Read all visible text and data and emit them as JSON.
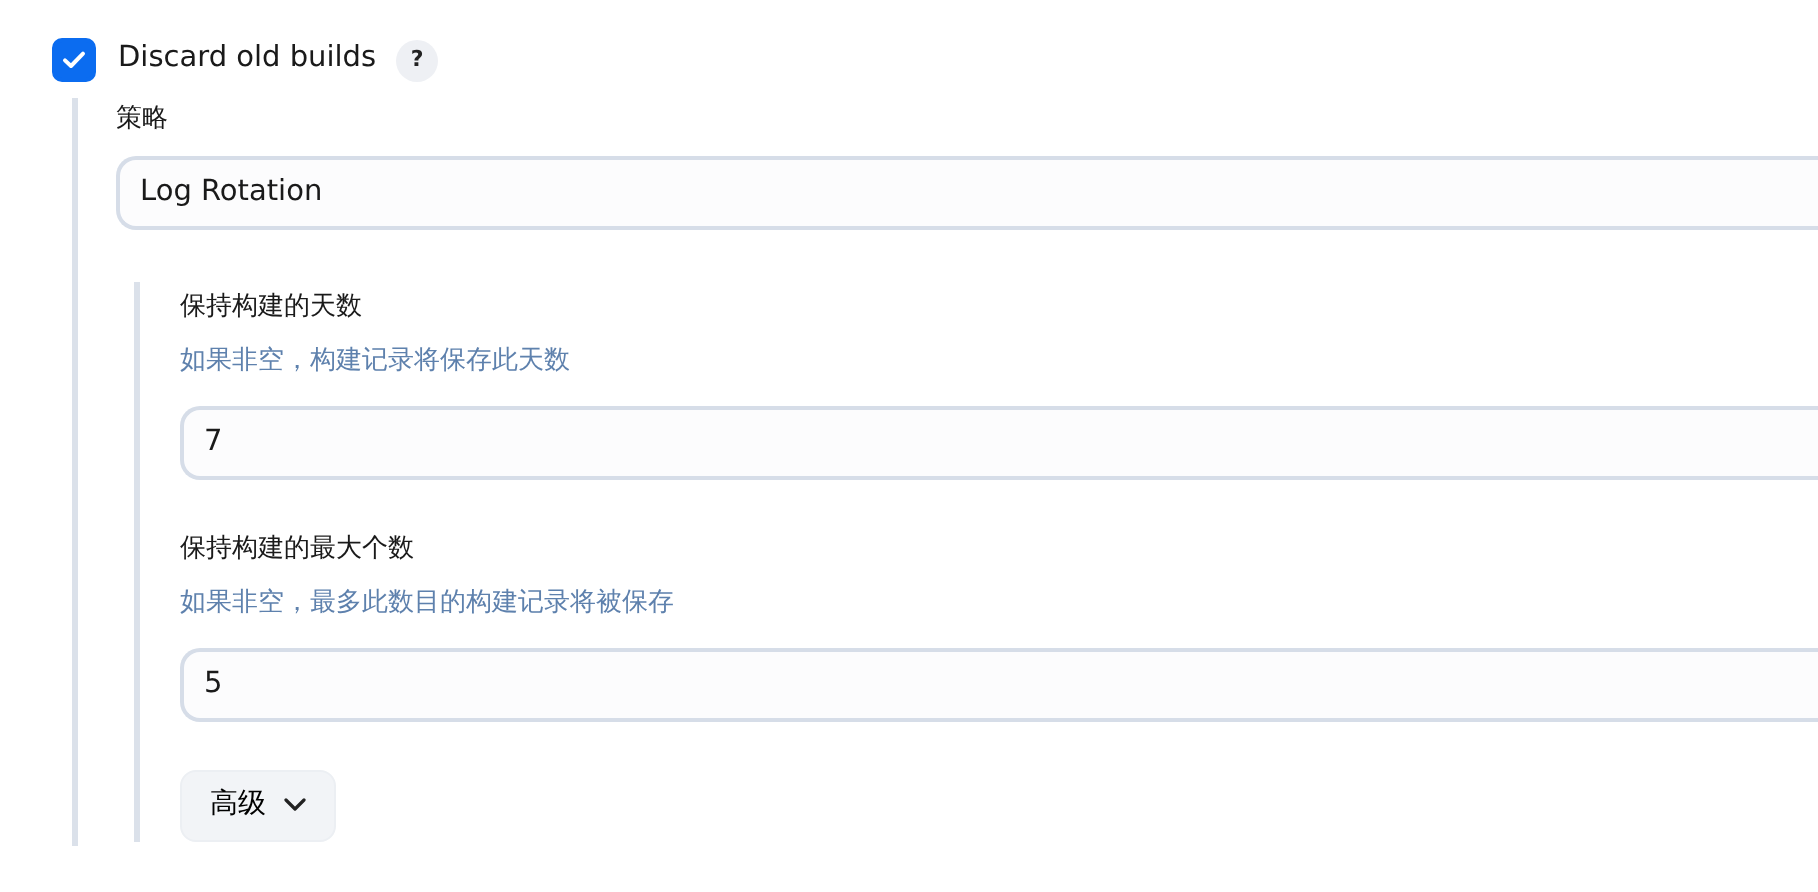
{
  "option": {
    "label": "Discard old builds",
    "checked": true,
    "help": "?"
  },
  "strategy": {
    "label": "策略",
    "value": "Log Rotation"
  },
  "fields": [
    {
      "label": "保持构建的天数",
      "hint": "如果非空，构建记录将保存此天数",
      "value": "7"
    },
    {
      "label": "保持构建的最大个数",
      "hint": "如果非空，最多此数目的构建记录将被保存",
      "value": "5"
    }
  ],
  "advanced_button": {
    "label": "高级"
  }
}
